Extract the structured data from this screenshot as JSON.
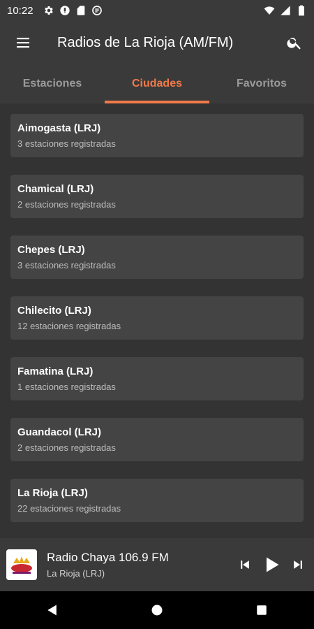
{
  "status_bar": {
    "time": "10:22",
    "icons_left": [
      "gear-icon",
      "mic-icon",
      "sim-card-icon",
      "sync-icon"
    ],
    "icons_right": [
      "wifi-icon",
      "signal-icon",
      "battery-icon"
    ]
  },
  "app_bar": {
    "title": "Radios de La Rioja (AM/FM)",
    "menu_icon": "menu-icon",
    "search_icon": "search-icon"
  },
  "tabs": [
    {
      "label": "Estaciones",
      "active": false
    },
    {
      "label": "Ciudades",
      "active": true
    },
    {
      "label": "Favoritos",
      "active": false
    }
  ],
  "cities": [
    {
      "name": "Aimogasta (LRJ)",
      "count": "3 estaciones registradas"
    },
    {
      "name": "Chamical (LRJ)",
      "count": "2 estaciones registradas"
    },
    {
      "name": "Chepes (LRJ)",
      "count": "3 estaciones registradas"
    },
    {
      "name": "Chilecito (LRJ)",
      "count": "12 estaciones registradas"
    },
    {
      "name": "Famatina (LRJ)",
      "count": "1 estaciones registradas"
    },
    {
      "name": "Guandacol (LRJ)",
      "count": "2 estaciones registradas"
    },
    {
      "name": "La Rioja (LRJ)",
      "count": "22 estaciones registradas"
    }
  ],
  "player": {
    "station": "Radio Chaya 106.9 FM",
    "location": "La Rioja (LRJ)",
    "controls": [
      "skip-previous-icon",
      "play-icon",
      "skip-next-icon"
    ]
  },
  "colors": {
    "accent": "#f07a4a",
    "background": "#333333",
    "card": "#444444",
    "bar": "#3a3a3a"
  }
}
